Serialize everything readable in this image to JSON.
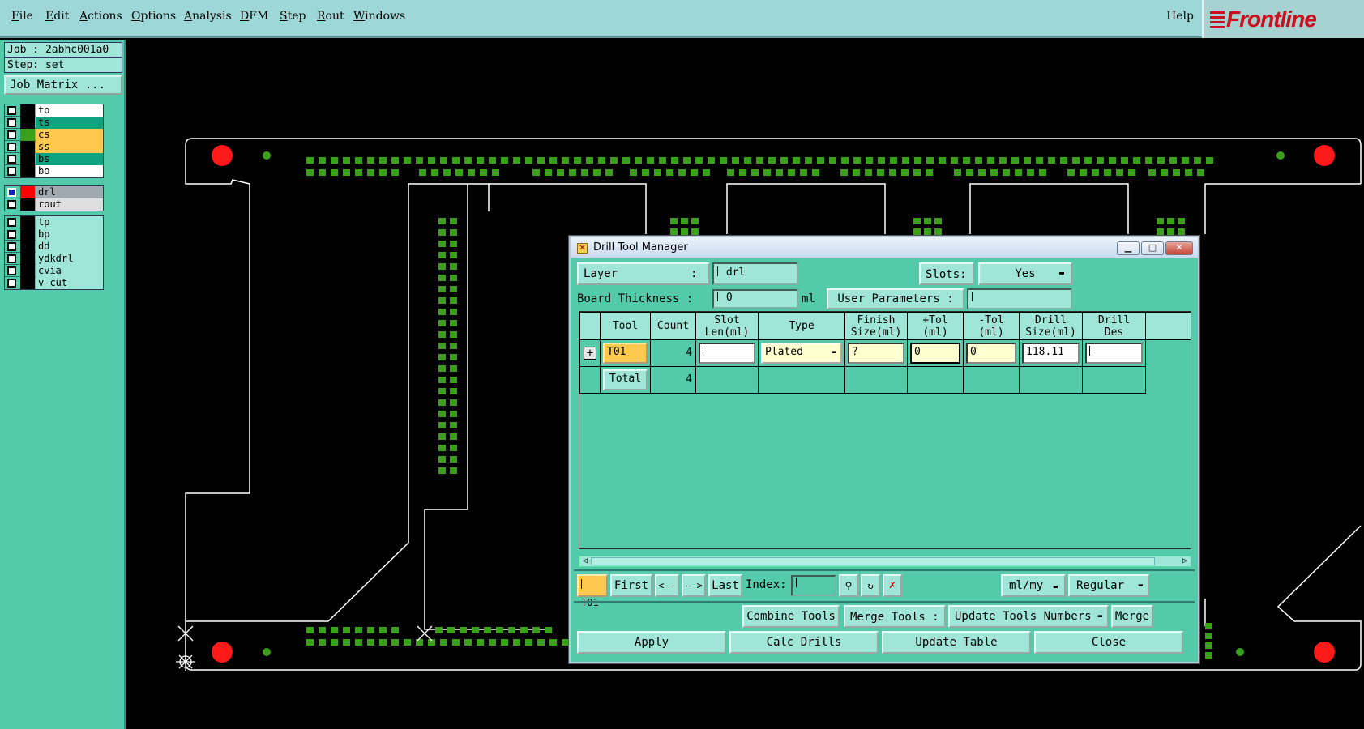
{
  "menubar": {
    "items": [
      "File",
      "Edit",
      "Actions",
      "Options",
      "Analysis",
      "DFM",
      "Step",
      "Rout",
      "Windows"
    ],
    "help": "Help",
    "logo": "Frontline"
  },
  "leftpanel": {
    "job": "Job : 2abhc001a0",
    "step": "Step: set",
    "job_matrix": "Job Matrix ..."
  },
  "layers": {
    "group1": [
      {
        "name": "to",
        "color": "#ffffff",
        "swatch": "#000000"
      },
      {
        "name": "ts",
        "color": "#0ea37f",
        "swatch": "#000000"
      },
      {
        "name": "cs",
        "color": "#ffc94f",
        "swatch": "#3aa01a"
      },
      {
        "name": "ss",
        "color": "#ffc94f",
        "swatch": "#000000"
      },
      {
        "name": "bs",
        "color": "#0ea37f",
        "swatch": "#000000"
      },
      {
        "name": "bo",
        "color": "#ffffff",
        "swatch": "#000000"
      }
    ],
    "group2": [
      {
        "name": "drl",
        "color": "#a0a8b0",
        "swatch": "#ff0000"
      },
      {
        "name": "rout",
        "color": "#dedede",
        "swatch": "#000000"
      }
    ],
    "group3": [
      {
        "name": "tp",
        "color": "#9fe6d8",
        "swatch": "#000000"
      },
      {
        "name": "bp",
        "color": "#9fe6d8",
        "swatch": "#000000"
      },
      {
        "name": "dd",
        "color": "#9fe6d8",
        "swatch": "#000000"
      },
      {
        "name": "ydkdrl",
        "color": "#9fe6d8",
        "swatch": "#000000"
      },
      {
        "name": "cvia",
        "color": "#9fe6d8",
        "swatch": "#000000"
      },
      {
        "name": "v-cut",
        "color": "#9fe6d8",
        "swatch": "#000000"
      }
    ]
  },
  "dialog": {
    "title": "Drill Tool Manager",
    "layer_label": "Layer",
    "layer_colon": ":",
    "layer_value": "drl",
    "slots_label": "Slots:",
    "slots_value": "Yes",
    "board_thickness_label": "Board Thickness :",
    "board_thickness_value": "0",
    "board_thickness_unit": "ml",
    "user_params_label": "User Parameters :",
    "user_params_value": "",
    "columns": [
      "Tool",
      "Count",
      "Slot\nLen(ml)",
      "Type",
      "Finish\nSize(ml)",
      "+Tol\n(ml)",
      "-Tol\n(ml)",
      "Drill\nSize(ml)",
      "Drill\nDes"
    ],
    "row": {
      "tool": "T01",
      "count": "4",
      "slot_len": "",
      "type": "Plated",
      "finish_size": "?",
      "plus_tol": "0",
      "minus_tol": "0",
      "drill_size": "118.11",
      "drill_des": ""
    },
    "total": {
      "label": "Total",
      "count": "4"
    },
    "nav": {
      "current": "T01",
      "first": "First",
      "prev": "<--",
      "next": "-->",
      "last": "Last",
      "index_label": "Index:",
      "index_value": "",
      "units": "ml/my",
      "mode": "Regular"
    },
    "actions": {
      "combine": "Combine Tools",
      "merge_label": "Merge Tools :",
      "merge_option": "Update Tools Numbers",
      "merge": "Merge",
      "apply": "Apply",
      "calc": "Calc Drills",
      "update": "Update Table",
      "close": "Close"
    }
  }
}
